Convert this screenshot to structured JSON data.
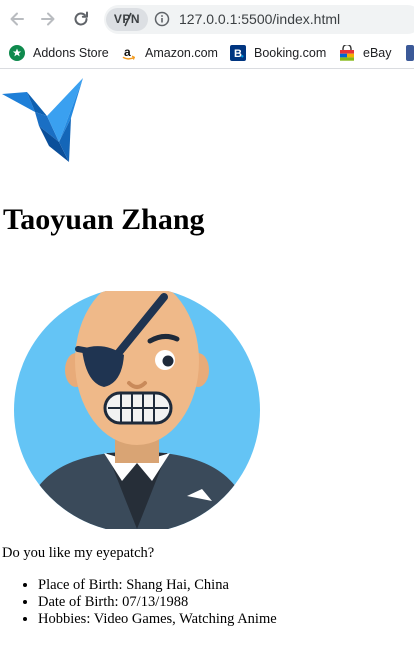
{
  "browser": {
    "back_icon": "arrow-left-icon",
    "forward_icon": "arrow-right-icon",
    "reload_icon": "reload-icon",
    "vpn_label": "VPN",
    "url": "127.0.0.1:5500/index.html"
  },
  "bookmarks": [
    {
      "label": "Addons Store",
      "icon": "addons-store-favicon"
    },
    {
      "label": "Amazon.com",
      "icon": "amazon-favicon"
    },
    {
      "label": "Booking.com",
      "icon": "booking-favicon"
    },
    {
      "label": "eBay",
      "icon": "ebay-favicon"
    }
  ],
  "page": {
    "title": "Taoyuan Zhang",
    "question": "Do you like my eyepatch?",
    "facts": [
      "Place of Birth: Shang Hai, China",
      "Date of Birth: 07/13/1988",
      "Hobbies: Video Games, Watching Anime"
    ]
  },
  "colors": {
    "avatar_background": "#64c4f5",
    "skin": "#efb989",
    "eyepatch": "#1f3451",
    "jacket": "#3a4a5a",
    "logo_blue": "#1e88e5"
  }
}
